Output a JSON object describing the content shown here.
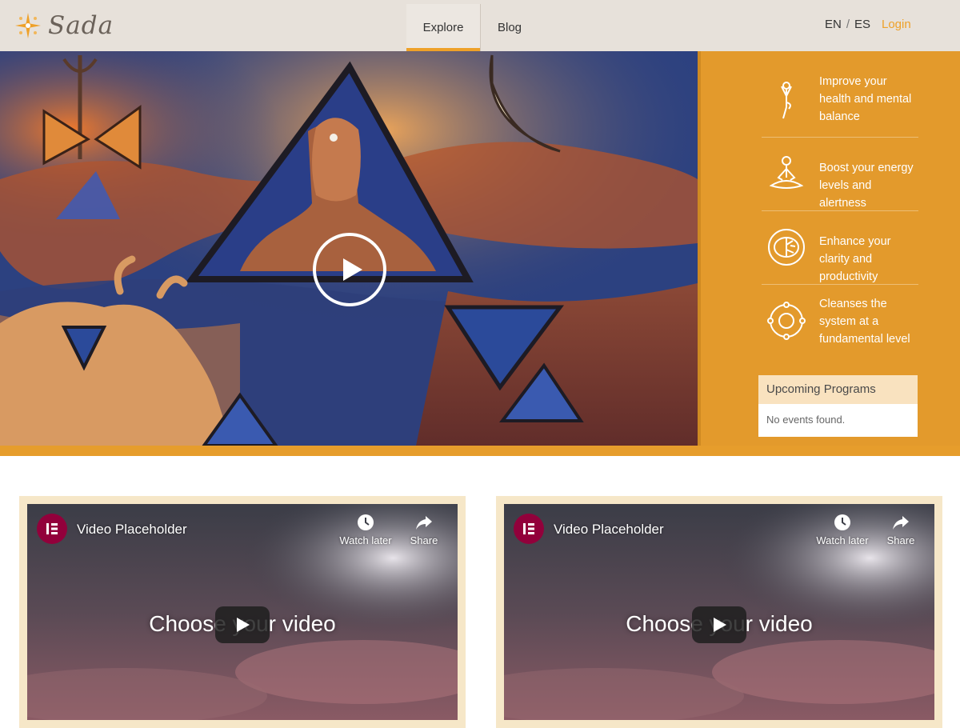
{
  "header": {
    "logo_text": "Sada",
    "nav": {
      "explore": "Explore",
      "blog": "Blog"
    },
    "lang": {
      "en": "EN",
      "separator": "/",
      "es": "ES"
    },
    "login": "Login"
  },
  "benefits": [
    {
      "icon": "tree-pose-icon",
      "text": "Improve your health and mental balance"
    },
    {
      "icon": "meditation-icon",
      "text": "Boost your energy levels and alertness"
    },
    {
      "icon": "brain-icon",
      "text": "Enhance your clarity and productivity"
    },
    {
      "icon": "orbit-icon",
      "text": "Cleanses the system at a fundamental level"
    }
  ],
  "programs": {
    "title": "Upcoming Programs",
    "empty": "No events found."
  },
  "videos": [
    {
      "title": "Video Placeholder",
      "watch_later": "Watch later",
      "share": "Share",
      "caption": "Choose your video"
    },
    {
      "title": "Video Placeholder",
      "watch_later": "Watch later",
      "share": "Share",
      "caption": "Choose your video"
    }
  ],
  "colors": {
    "accent": "#eea129",
    "header_bg": "#e7e1da",
    "side_bg": "#e39a2c",
    "card_border": "#f6e7c8"
  }
}
